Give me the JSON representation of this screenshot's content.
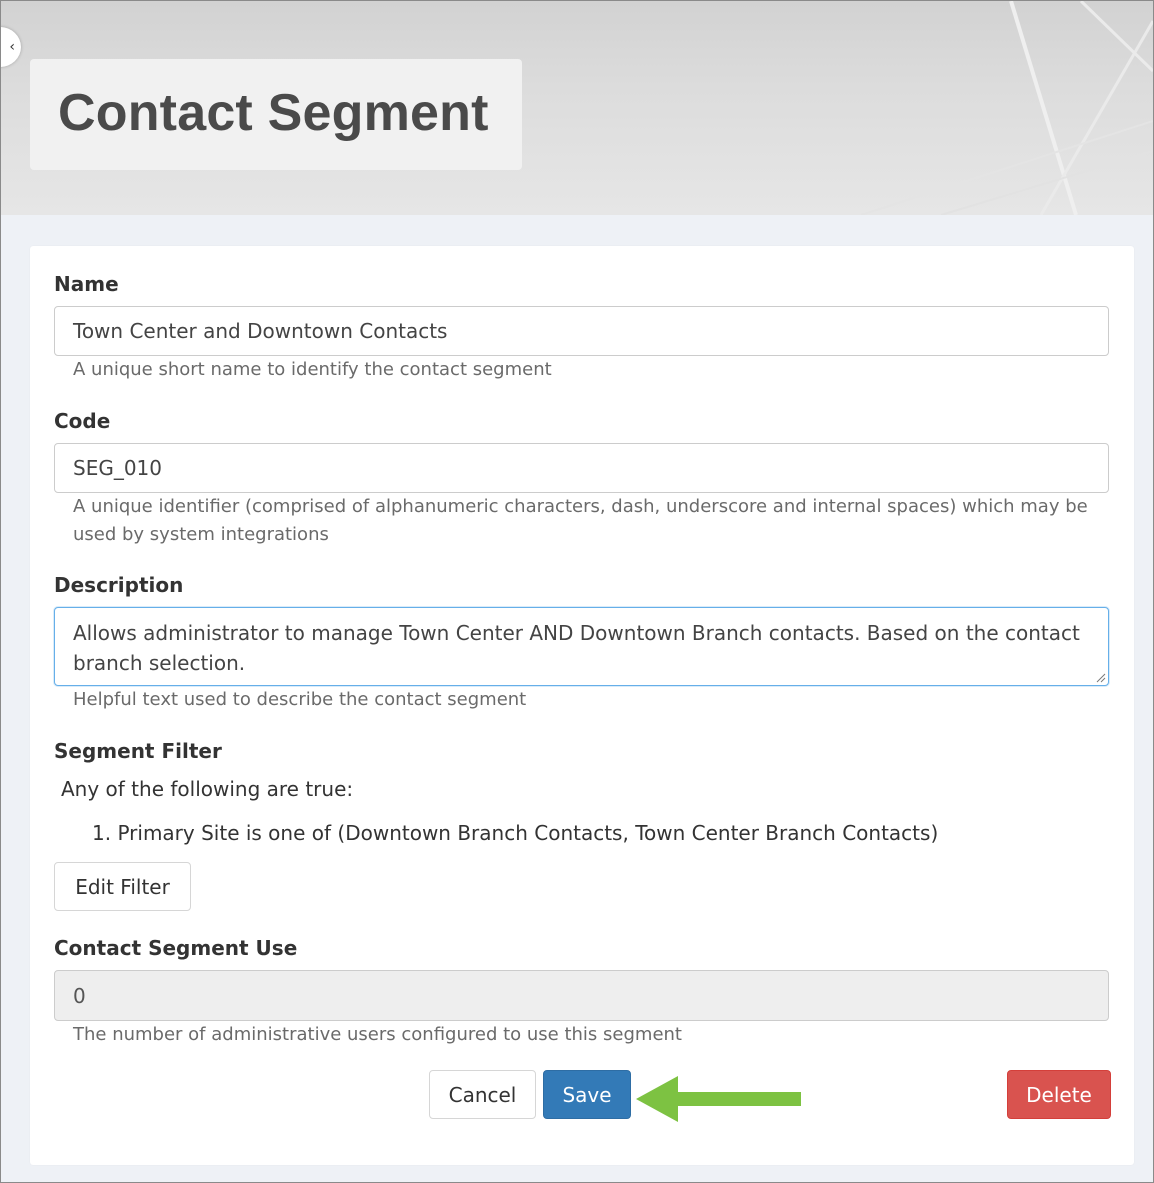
{
  "header": {
    "title": "Contact Segment",
    "collapse_icon": "chevron-left-icon"
  },
  "form": {
    "name": {
      "label": "Name",
      "value": "Town Center and Downtown Contacts",
      "help": "A unique short name to identify the contact segment"
    },
    "code": {
      "label": "Code",
      "value": "SEG_010",
      "help": "A unique identifier (comprised of alphanumeric characters, dash, underscore and internal spaces) which may be used by system integrations"
    },
    "description": {
      "label": "Description",
      "value": "Allows administrator to manage Town Center AND Downtown Branch contacts. Based on the contact branch selection.",
      "help": "Helpful text used to describe the contact segment"
    },
    "segment_filter": {
      "label": "Segment Filter",
      "intro": "Any of the following are true:",
      "conditions": [
        "Primary Site is one of (Downtown Branch Contacts, Town Center Branch Contacts)"
      ],
      "edit_label": "Edit Filter"
    },
    "usage": {
      "label": "Contact Segment Use",
      "value": "0",
      "help": "The number of administrative users configured to use this segment"
    }
  },
  "actions": {
    "cancel": "Cancel",
    "save": "Save",
    "delete": "Delete"
  },
  "colors": {
    "primary": "#337ab7",
    "danger": "#d9534f",
    "annotation_arrow": "#7dc242"
  }
}
